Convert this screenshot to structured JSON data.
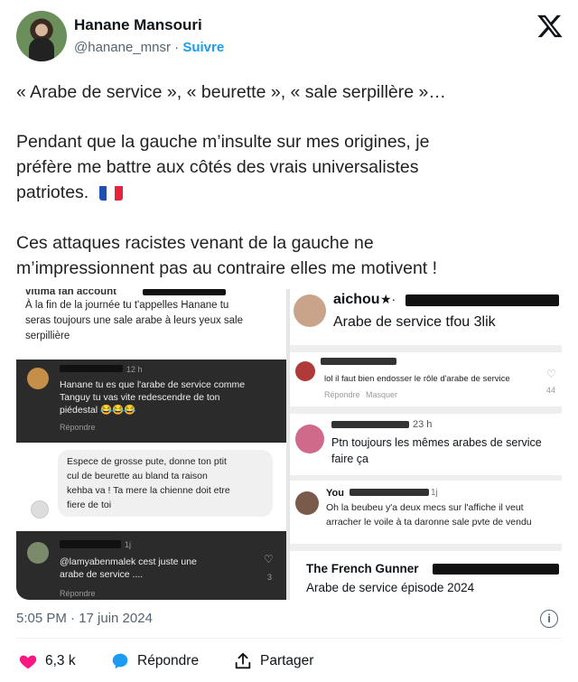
{
  "author": {
    "name": "Hanane Mansouri",
    "handle": "@hanane_mnsr",
    "separator": "·",
    "follow_label": "Suivre"
  },
  "tweet": {
    "line1": "« Arabe de service », « beurette », « sale serpillère »…",
    "p2_l1": "Pendant que la gauche m’insulte sur mes origines, je",
    "p2_l2": "préfère me battre aux côtés des vrais universalistes",
    "p2_l3": "patriotes.",
    "p3_l1": "Ces attaques racistes venant de la gauche  ne",
    "p3_l2": "m’impressionnent pas au contraire elles me motivent !"
  },
  "media_left": {
    "top_name": "vitima fan account",
    "top_l1": "À la fin de la journée tu t'appelles Hanane tu",
    "top_l2": "seras toujours une sale arabe à leurs yeux sale",
    "top_l3": "serpillière",
    "c1_time": "12 h",
    "c1_l1": "Hanane tu es que l'arabe de service comme",
    "c1_l2": "Tanguy tu vas vite redescendre de ton",
    "c1_l3": "piédestal 😂😂😂",
    "c1_reply": "Répondre",
    "c2_l1": "Espece de grosse pute, donne ton ptit",
    "c2_l2": "cul de beurette au bland ta raison",
    "c2_l3": "kehba va ! Ta mere la chienne doit etre",
    "c2_l4": "fiere de toi",
    "c3_time": "1j",
    "c3_l1": "@lamyabenmalek  cest juste une",
    "c3_l2": "arabe de service ....",
    "c3_reply": "Répondre",
    "c3_likes": "3"
  },
  "media_right": {
    "r1_name": "aichou",
    "r1_text": "Arabe de service tfou 3lik",
    "r2_text": "lol il faut bien endosser le rôle d'arabe de service",
    "r2_reply": "Répondre",
    "r2_hide": "Masquer",
    "r2_likes": "44",
    "r3_time": "23 h",
    "r3_l1": "Ptn toujours les mêmes arabes de service",
    "r3_l2": "faire ça",
    "r4_name": "You",
    "r4_time": "1j",
    "r4_l1": "Oh la beubeu y'a deux  mecs sur l'affiche il veut",
    "r4_l2": "arracher le voile à ta daronne sale pvte de vendu",
    "r5_name": "The French Gunner",
    "r5_text": "Arabe de service épisode 2024"
  },
  "footer": {
    "timestamp": "5:05 PM · 17 juin 2024",
    "info_icon": "i",
    "likes": "6,3 k",
    "reply_label": "Répondre",
    "share_label": "Partager"
  },
  "colors": {
    "like": "#f91880",
    "reply": "#1d9bf0",
    "follow": "#1d9bf0"
  }
}
